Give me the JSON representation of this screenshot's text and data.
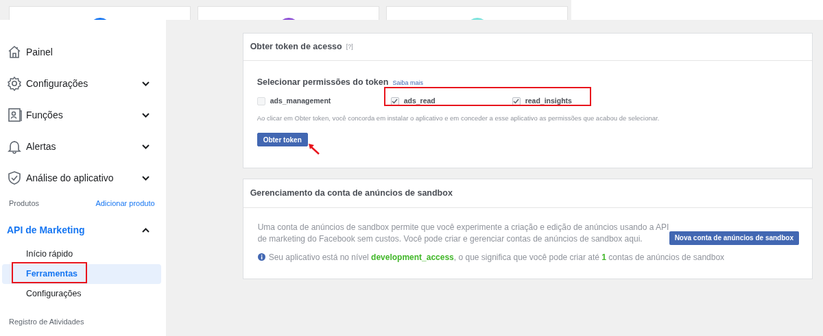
{
  "sidebar": {
    "nav": [
      {
        "label": "Painel"
      },
      {
        "label": "Configurações",
        "expanded": false
      },
      {
        "label": "Funções",
        "expanded": false
      },
      {
        "label": "Alertas",
        "expanded": false
      },
      {
        "label": "Análise do aplicativo",
        "expanded": false
      }
    ],
    "products_heading": "Produtos",
    "add_product_link": "Adicionar produto",
    "product": {
      "label": "API de Marketing",
      "expanded": true,
      "children": [
        {
          "label": "Início rápido",
          "selected": false
        },
        {
          "label": "Ferramentas",
          "selected": true
        },
        {
          "label": "Configurações",
          "selected": false
        }
      ]
    },
    "activity_heading": "Registro de Atividades"
  },
  "token_card": {
    "title": "Obter token de acesso",
    "help": "[?]",
    "permissions_heading": "Selecionar permissões do token",
    "learn_more_link": "Saiba mais",
    "permissions": [
      {
        "label": "ads_management",
        "checked": false
      },
      {
        "label": "ads_read",
        "checked": true
      },
      {
        "label": "read_insights",
        "checked": true
      }
    ],
    "note": "Ao clicar em Obter token, você concorda em instalar o aplicativo e em conceder a esse aplicativo as permissões que acabou de selecionar.",
    "button": "Obter token"
  },
  "sandbox_card": {
    "title": "Gerenciamento da conta de anúncios de sandbox",
    "description": "Uma conta de anúncios de sandbox permite que você experimente a criação e edição de anúncios usando a API de marketing do Facebook sem custos. Você pode criar e gerenciar contas de anúncios de sandbox aqui.",
    "button": "Nova conta de anúncios de sandbox",
    "info": "Seu aplicativo está no nível **development_access**, o que significa que você pode criar até **1** contas de anúncios de sandbox"
  }
}
